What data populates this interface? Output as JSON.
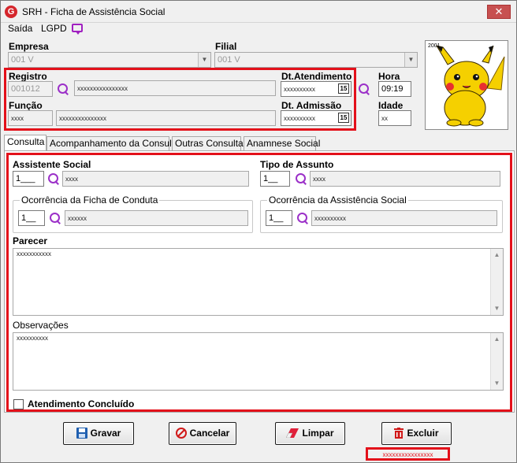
{
  "window": {
    "title": "SRH - Ficha de Assistência Social",
    "close_symbol": "✕"
  },
  "menu": {
    "saida": "Saída",
    "lgpd": "LGPD"
  },
  "header": {
    "empresa_label": "Empresa",
    "empresa_value": "001 V",
    "filial_label": "Filial",
    "filial_value": "001 V",
    "registro_label": "Registro",
    "registro_value": "001012",
    "registro_name": "xxxxxxxxxxxxxxxx",
    "dt_atendimento_label": "Dt.Atendimento",
    "dt_atendimento_value": "xxxxxxxxxx",
    "hora_label": "Hora",
    "hora_value": "09:19",
    "funcao_label": "Função",
    "funcao_code": "xxxx",
    "funcao_desc": "xxxxxxxxxxxxxxx",
    "dt_admissao_label": "Dt. Admissão",
    "dt_admissao_value": "xxxxxxxxxx",
    "idade_label": "Idade",
    "idade_value": "xx",
    "calendar_day": "15",
    "photo_caption": "2001"
  },
  "tabs": [
    "Consulta",
    "Acompanhamento da Consulta",
    "Outras Consultas",
    "Anamnese Social"
  ],
  "consulta": {
    "assistente_label": "Assistente Social",
    "assistente_code": "1___",
    "assistente_desc": "xxxx",
    "tipo_label": "Tipo de Assunto",
    "tipo_code": "1__",
    "tipo_desc": "xxxx",
    "ocorr_conduta_label": "Ocorrência da Ficha de Conduta",
    "ocorr_conduta_code": "1__",
    "ocorr_conduta_desc": "xxxxxx",
    "ocorr_assist_label": "Ocorrência da Assistência Social",
    "ocorr_assist_code": "1__",
    "ocorr_assist_desc": "xxxxxxxxxx",
    "parecer_label": "Parecer",
    "parecer_text": "xxxxxxxxxxx",
    "obs_label": "Observações",
    "obs_text": "xxxxxxxxxx",
    "concluido_label": "Atendimento Concluído"
  },
  "buttons": {
    "gravar": "Gravar",
    "cancelar": "Cancelar",
    "limpar": "Limpar",
    "excluir": "Excluir"
  },
  "status": {
    "text": "xxxxxxxxxxxxxxxx"
  },
  "colors": {
    "highlight": "#e3101a",
    "accent_icon": "#9b30c8"
  }
}
